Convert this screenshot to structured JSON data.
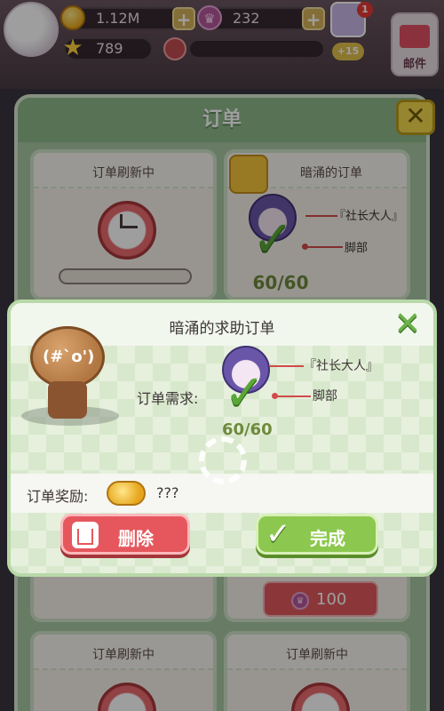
{
  "hud": {
    "gold": "1.12M",
    "crowns": "232",
    "stars": "789",
    "notification_count": "1",
    "boost": "+15",
    "mail_label": "邮件"
  },
  "order_panel": {
    "title": "订单",
    "cards": [
      {
        "title": "订单刷新中",
        "state": "refreshing"
      },
      {
        "title": "暗涌的订单",
        "state": "complete",
        "progress": "60/60",
        "tags": [
          "『社长大人』",
          "脚部"
        ]
      },
      {
        "title": "订单刷新中",
        "state": "refreshing"
      },
      {
        "title": "订单刷新中",
        "state": "refreshing"
      }
    ],
    "hidden_price": "100"
  },
  "dialog": {
    "title": "暗涌的求助订单",
    "requirement_label": "订单需求:",
    "tags": [
      "『社长大人』",
      "脚部"
    ],
    "progress": "60/60",
    "reward_label": "订单奖励:",
    "reward_value": "???",
    "delete_label": "删除",
    "complete_label": "完成",
    "cookie_face": "(#`o')"
  },
  "colors": {
    "panel_green": "#a9c7a4",
    "progress_green": "#6e8a3c",
    "delete_red": "#e5575d",
    "complete_green": "#8cc84f",
    "tag_red": "#d24b4b"
  },
  "icons": [
    "gold-coin-icon",
    "crown-icon",
    "star-icon",
    "clock-icon",
    "mail-icon",
    "close-icon",
    "alarm-clock-icon",
    "check-icon",
    "trash-icon",
    "coins-icon",
    "spinner-icon"
  ]
}
